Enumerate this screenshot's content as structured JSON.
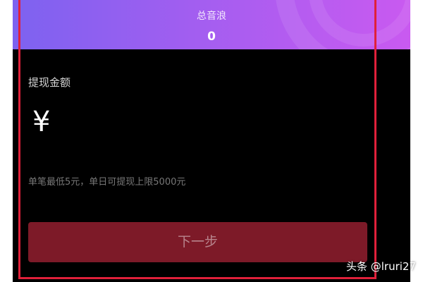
{
  "header": {
    "label": "总音浪",
    "value": "0"
  },
  "withdraw": {
    "amount_label": "提现金额",
    "currency_symbol": "¥",
    "amount_value": "",
    "hint": "单笔最低5元，单日可提现上限5000元"
  },
  "actions": {
    "next_label": "下一步"
  },
  "watermark": {
    "text": "头条 @lruri27"
  },
  "colors": {
    "header_gradient_start": "#7d62f0",
    "header_gradient_end": "#c95af0",
    "background": "#000000",
    "button_bg": "#7d1a28",
    "button_text": "#b8858d",
    "highlight_frame": "#e0203a"
  }
}
